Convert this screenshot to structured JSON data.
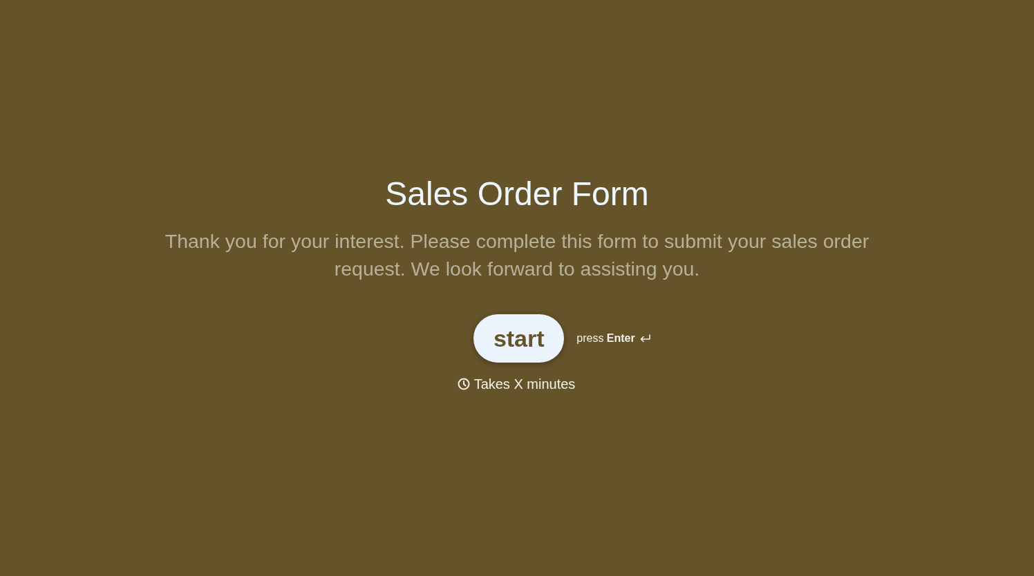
{
  "title": "Sales Order Form",
  "description": "Thank you for your interest. Please complete this form to submit your sales order request. We look forward to assisting you.",
  "start_button": {
    "label": "start"
  },
  "hint": "press **Enter**",
  "duration": "Takes X minutes"
}
